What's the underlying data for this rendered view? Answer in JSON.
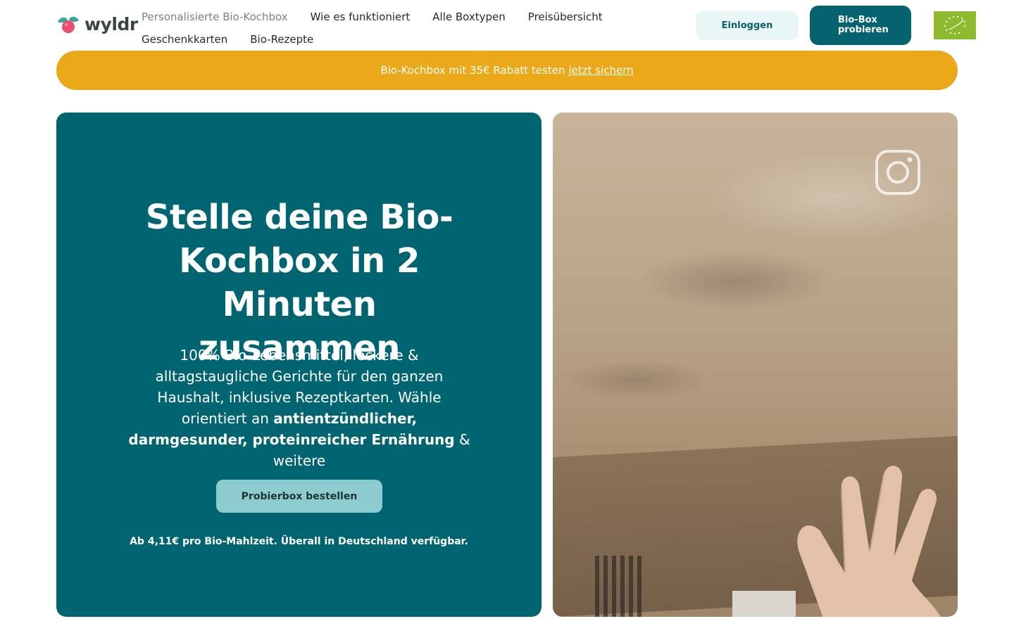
{
  "brand": {
    "name": "wyldr"
  },
  "nav": {
    "items": [
      {
        "label": "Personalisierte Bio-Kochbox",
        "active": true
      },
      {
        "label": "Wie es funktioniert"
      },
      {
        "label": "Alle Boxtypen"
      },
      {
        "label": "Preisübersicht"
      },
      {
        "label": "Geschenkkarten"
      },
      {
        "label": "Bio-Rezepte"
      }
    ]
  },
  "header": {
    "login_label": "Einloggen",
    "try_label_line1": "Bio-Box",
    "try_label_line2": "probieren",
    "badge_icon": "eu-organic-leaf-icon"
  },
  "promo": {
    "text": "Bio-Kochbox mit 35€ Rabatt testen",
    "link": "jetzt sichern",
    "color": "#eba91a"
  },
  "hero": {
    "title": "Stelle deine Bio-Kochbox in 2 Minuten zusammen",
    "subtitle_part1": "100% Bio-Lebensmittel, leckere & alltagstaugliche Gerichte für den ganzen Haushalt, inklusive Rezeptkarten. Wähle orientiert an",
    "subtitle_bold": "antientzündlicher, darmgesunder, proteinreicher Ernährung",
    "subtitle_part2": "& weitere",
    "cta_label": "Probierbox bestellen",
    "footnote": "Ab 4,11€ pro Bio-Mahlzeit. Überall in Deutschland verfügbar.",
    "background_color": "#006570"
  },
  "media": {
    "icon": "instagram-icon",
    "content": "video-unboxing"
  },
  "colors": {
    "primary": "#04636e",
    "accent_light": "#8ecbcf",
    "login_bg": "#e9f6f6",
    "eu_green": "#8dbb2d"
  }
}
